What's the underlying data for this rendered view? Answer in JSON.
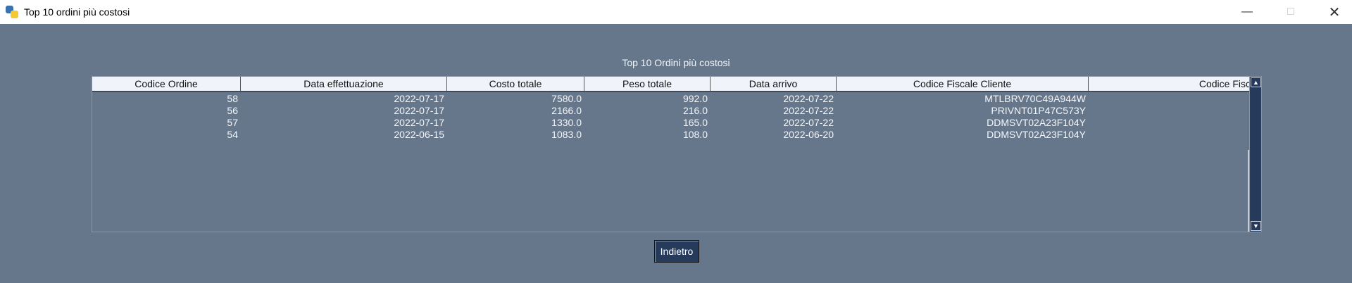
{
  "window": {
    "title": "Top 10 ordini più costosi",
    "icon": "python-icon"
  },
  "heading": "Top 10 Ordini più costosi",
  "table": {
    "columns": [
      "Codice Ordine",
      "Data effettuazione",
      "Costo totale",
      "Peso totale",
      "Data arrivo",
      "Codice Fiscale Cliente",
      "Codice Fisc"
    ],
    "rows": [
      [
        "58",
        "2022-07-17",
        "7580.0",
        "992.0",
        "2022-07-22",
        "MTLBRV70C49A944W",
        ""
      ],
      [
        "56",
        "2022-07-17",
        "2166.0",
        "216.0",
        "2022-07-22",
        "PRIVNT01P47C573Y",
        ""
      ],
      [
        "57",
        "2022-07-17",
        "1330.0",
        "165.0",
        "2022-07-22",
        "DDMSVT02A23F104Y",
        ""
      ],
      [
        "54",
        "2022-06-15",
        "1083.0",
        "108.0",
        "2022-06-20",
        "DDMSVT02A23F104Y",
        ""
      ]
    ]
  },
  "back_button": "Indietro",
  "colors": {
    "background": "#66778c",
    "header": "#f0f3f9",
    "accent": "#263a5c"
  }
}
